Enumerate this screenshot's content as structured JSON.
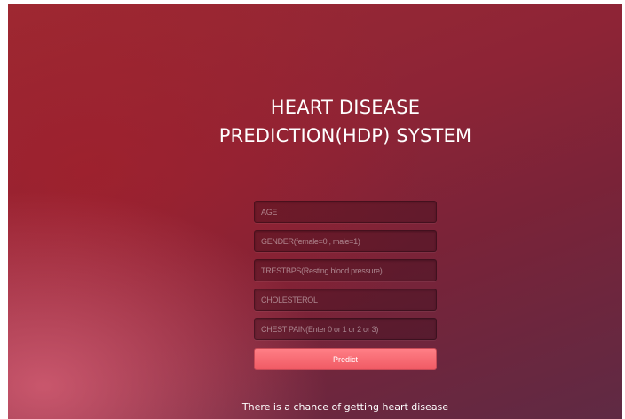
{
  "page": {
    "title": "HEART DISEASE PREDICTION(HDP) SYSTEM"
  },
  "form": {
    "fields": [
      {
        "placeholder": "AGE",
        "value": ""
      },
      {
        "placeholder": "GENDER(female=0 , male=1)",
        "value": ""
      },
      {
        "placeholder": "TRESTBPS(Resting blood pressure)",
        "value": ""
      },
      {
        "placeholder": "CHOLESTEROL",
        "value": ""
      },
      {
        "placeholder": "CHEST PAIN(Enter 0 or 1 or 2 or 3)",
        "value": ""
      }
    ],
    "submit_label": "Predict"
  },
  "result": {
    "text": "There is a chance of getting heart disease"
  },
  "colors": {
    "background_start": "#9c2a33",
    "background_end": "#5f2a44",
    "button": "#f56b73",
    "text": "#ffffff"
  }
}
